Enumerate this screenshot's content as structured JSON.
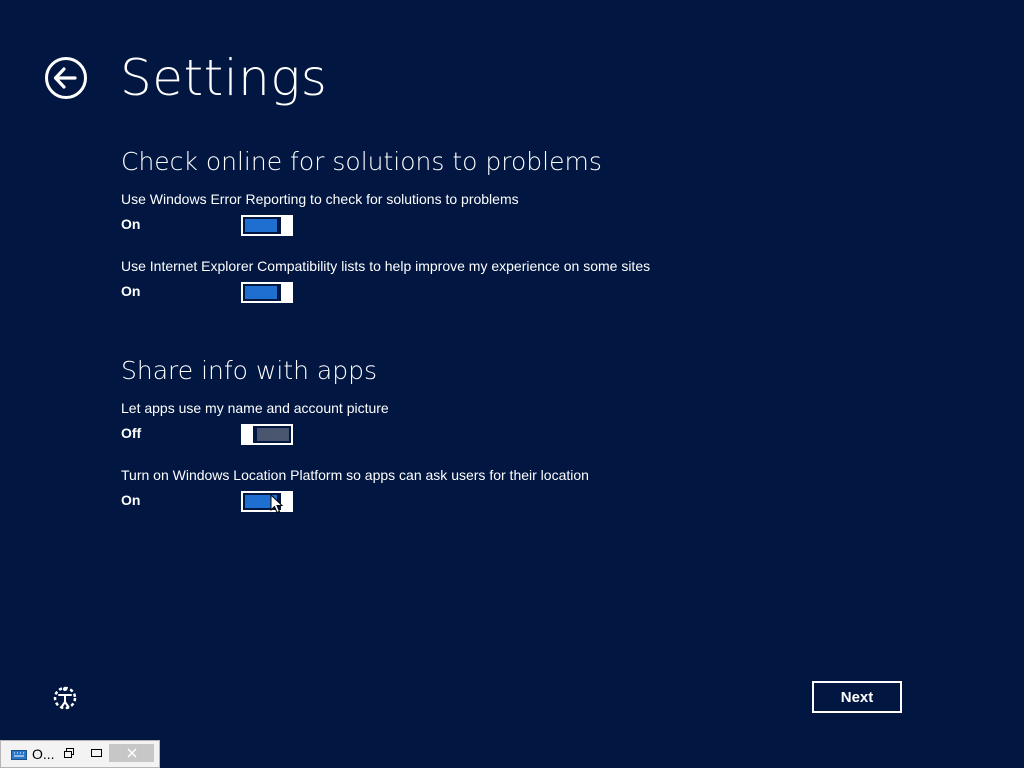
{
  "header": {
    "title": "Settings",
    "back_icon": "back-arrow-icon"
  },
  "sections": [
    {
      "heading": "Check online for solutions to problems",
      "settings": [
        {
          "description": "Use Windows Error Reporting to check for solutions to problems",
          "state": "On"
        },
        {
          "description": "Use Internet Explorer Compatibility lists to help improve my experience on some sites",
          "state": "On"
        }
      ]
    },
    {
      "heading": "Share info with apps",
      "settings": [
        {
          "description": "Let apps use my name and account picture",
          "state": "Off"
        },
        {
          "description": "Turn on Windows Location Platform so apps can ask users for their location",
          "state": "On"
        }
      ]
    }
  ],
  "footer": {
    "ease_of_access_icon": "ease-of-access-icon",
    "next_label": "Next"
  },
  "mini_window": {
    "title": "O...",
    "icon": "keyboard-icon"
  },
  "colors": {
    "background": "#011640",
    "toggle_on": "#1e6fcf",
    "toggle_off": "#4a5670",
    "foreground": "#ffffff"
  }
}
